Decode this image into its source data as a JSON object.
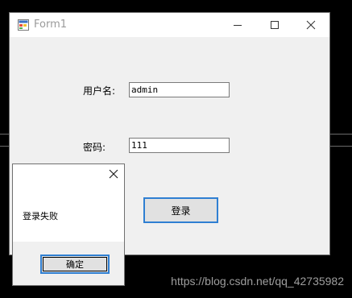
{
  "window": {
    "title": "Form1",
    "minimize_icon": "minimize-icon",
    "maximize_icon": "maximize-icon",
    "close_icon": "close-icon"
  },
  "form": {
    "username_label": "用户名:",
    "username_value": "admin",
    "password_label": "密码:",
    "password_value": "111",
    "login_button": "登录"
  },
  "message_box": {
    "text": "登录失败",
    "ok_button": "确定",
    "close_icon": "close-icon"
  },
  "watermark": "https://blog.csdn.net/qq_42735982",
  "colors": {
    "focus_border": "#2f7fd2",
    "window_bg": "#f0f0f0",
    "desktop": "#000000"
  }
}
